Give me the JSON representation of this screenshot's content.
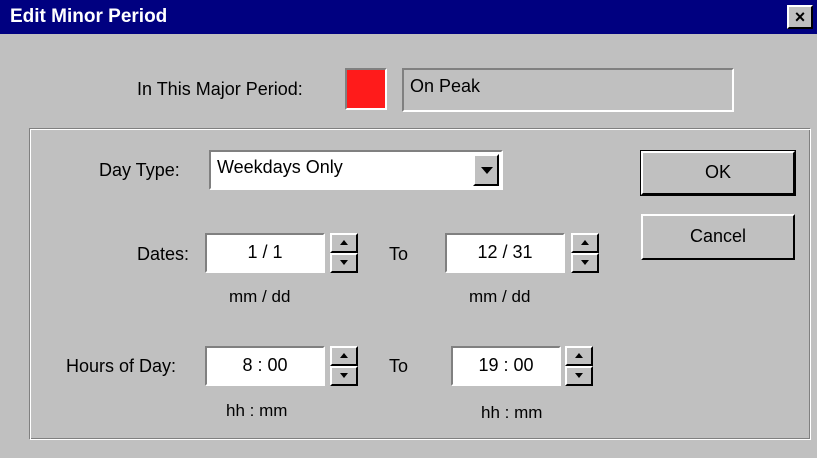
{
  "window": {
    "title": "Edit Minor Period",
    "close_symbol": "×"
  },
  "major_period": {
    "label": "In This Major Period:",
    "color": "#ff1b1b",
    "name": "On Peak"
  },
  "day_type": {
    "label": "Day Type:",
    "selected": "Weekdays Only"
  },
  "dates": {
    "label": "Dates:",
    "from": "1 / 1",
    "to_label": "To",
    "to": "12 / 31",
    "format_hint": "mm / dd"
  },
  "hours": {
    "label": "Hours of Day:",
    "from": "8 :  00",
    "to_label": "To",
    "to": "19 : 00",
    "format_hint": "hh : mm"
  },
  "buttons": {
    "ok": "OK",
    "cancel": "Cancel"
  }
}
